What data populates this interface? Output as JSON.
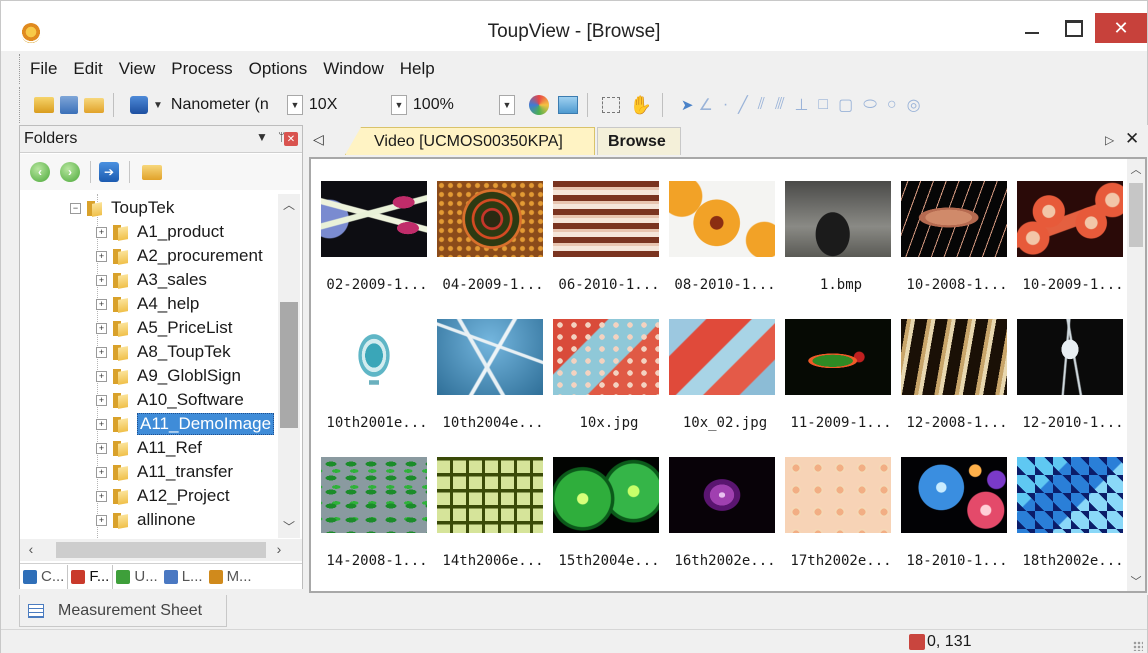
{
  "window": {
    "title": "ToupView - [Browse]",
    "close_glyph": "✕"
  },
  "menu": [
    "File",
    "Edit",
    "View",
    "Process",
    "Options",
    "Window",
    "Help"
  ],
  "toolbar": {
    "unit_value": "Nanometer (n",
    "magnification_value": "10X",
    "zoom_value": "100%",
    "measure_icons": [
      "ptr-icon",
      "angle-icon",
      "point-icon",
      "line-icon",
      "parallel-icon",
      "multi-parallel-icon",
      "perpendicular-icon",
      "rectangle-icon",
      "rounded-rect-icon",
      "ellipse-icon",
      "circle-icon",
      "annulus-icon"
    ]
  },
  "folders_panel": {
    "title": "Folders",
    "tree": [
      {
        "label": "ToupTek",
        "expander": "−",
        "indent": 0
      },
      {
        "label": "A1_product",
        "expander": "+",
        "indent": 1
      },
      {
        "label": "A2_procurement",
        "expander": "+",
        "indent": 1
      },
      {
        "label": "A3_sales",
        "expander": "+",
        "indent": 1
      },
      {
        "label": "A4_help",
        "expander": "+",
        "indent": 1
      },
      {
        "label": "A5_PriceList",
        "expander": "+",
        "indent": 1
      },
      {
        "label": "A8_ToupTek",
        "expander": "+",
        "indent": 1
      },
      {
        "label": "A9_GloblSign",
        "expander": "+",
        "indent": 1
      },
      {
        "label": "A10_Software",
        "expander": "+",
        "indent": 1
      },
      {
        "label": "A11_DemoImage",
        "expander": "+",
        "indent": 1,
        "selected": true
      },
      {
        "label": "A11_Ref",
        "expander": "+",
        "indent": 1
      },
      {
        "label": "A11_transfer",
        "expander": "+",
        "indent": 1
      },
      {
        "label": "A12_Project",
        "expander": "+",
        "indent": 1
      },
      {
        "label": "allinone",
        "expander": "+",
        "indent": 1
      }
    ],
    "tabs": [
      {
        "label": "C...",
        "color": "#2f6fb8"
      },
      {
        "label": "F...",
        "color": "#c93a2b",
        "active": true
      },
      {
        "label": "U...",
        "color": "#3e9f3a"
      },
      {
        "label": "L...",
        "color": "#4a78c2"
      },
      {
        "label": "M...",
        "color": "#d08a1c"
      }
    ]
  },
  "measurement_tab": {
    "label": "Measurement Sheet"
  },
  "doc_tabs": {
    "video_label": "Video [UCMOS00350KPA]",
    "browse_label": "Browse"
  },
  "thumbnails": [
    {
      "label": "02-2009-1...",
      "img": "img-01"
    },
    {
      "label": "04-2009-1...",
      "img": "img-02"
    },
    {
      "label": "06-2010-1...",
      "img": "img-03"
    },
    {
      "label": "08-2010-1...",
      "img": "img-04"
    },
    {
      "label": "1.bmp",
      "img": "img-05"
    },
    {
      "label": "10-2008-1...",
      "img": "img-06"
    },
    {
      "label": "10-2009-1...",
      "img": "img-07"
    },
    {
      "label": "10th2001e...",
      "img": "img-08"
    },
    {
      "label": "10th2004e...",
      "img": "img-09"
    },
    {
      "label": "10x.jpg",
      "img": "img-10"
    },
    {
      "label": "10x_02.jpg",
      "img": "img-11"
    },
    {
      "label": "11-2009-1...",
      "img": "img-12"
    },
    {
      "label": "12-2008-1...",
      "img": "img-13"
    },
    {
      "label": "12-2010-1...",
      "img": "img-14"
    },
    {
      "label": "14-2008-1...",
      "img": "img-15"
    },
    {
      "label": "14th2006e...",
      "img": "img-16"
    },
    {
      "label": "15th2004e...",
      "img": "img-17"
    },
    {
      "label": "16th2002e...",
      "img": "img-18"
    },
    {
      "label": "17th2002e...",
      "img": "img-19"
    },
    {
      "label": "18-2010-1...",
      "img": "img-20"
    },
    {
      "label": "18th2002e...",
      "img": "img-21"
    }
  ],
  "status": {
    "coords": "0, 131"
  }
}
